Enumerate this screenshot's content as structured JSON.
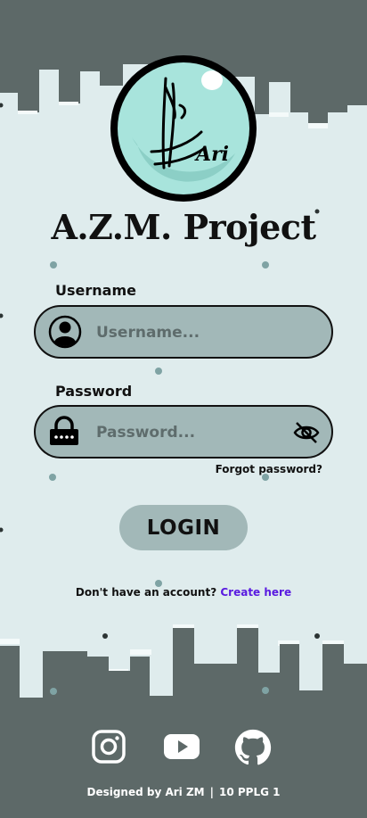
{
  "app": {
    "title": "A.Z.M. Project",
    "logo_text": "Ari"
  },
  "form": {
    "username_label": "Username",
    "username_placeholder": "Username...",
    "password_label": "Password",
    "password_placeholder": "Password...",
    "forgot_password": "Forgot password?",
    "login_button": "LOGIN"
  },
  "signup": {
    "prompt": "Don't have an account?",
    "link": "Create here"
  },
  "social": [
    "instagram-icon",
    "youtube-icon",
    "github-icon"
  ],
  "footer": {
    "designer": "Designed by Ari ZM",
    "class": "10 PPLG 1"
  },
  "colors": {
    "background": "#dfeced",
    "skyline": "#5d6968",
    "field": "#a2b8b8",
    "logo_fill": "#a8e4dc",
    "link": "#5a1be0"
  }
}
